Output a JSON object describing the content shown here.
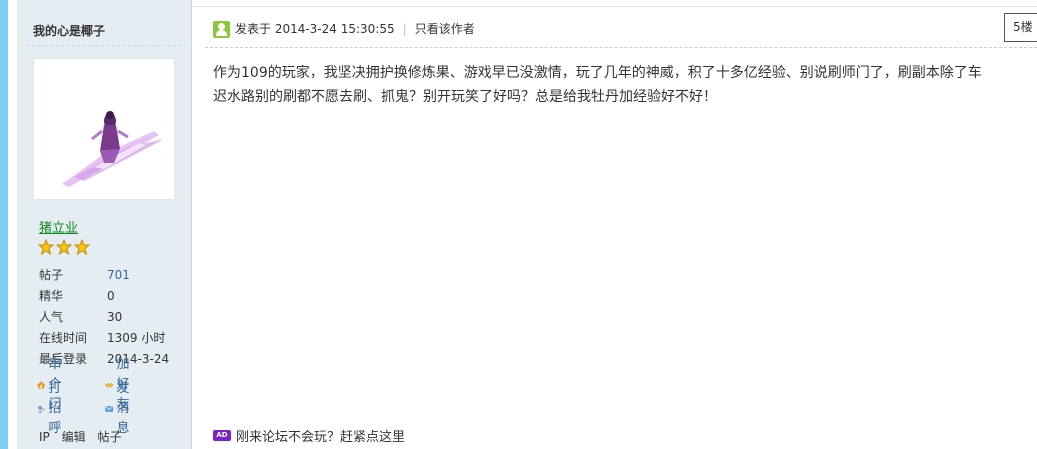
{
  "author": {
    "name": "我的心是椰子",
    "group": "猪立业",
    "stats": [
      {
        "label": "帖子",
        "value": "701"
      },
      {
        "label": "精华",
        "value": "0"
      },
      {
        "label": "人气",
        "value": "30"
      },
      {
        "label": "在线时间",
        "value": "1309 小时"
      },
      {
        "label": "最后登录",
        "value": "2014-3-24"
      }
    ],
    "actions": {
      "visit": "串个门",
      "add_friend": "加好友",
      "greet": "打招呼",
      "message": "发消息"
    },
    "footer": [
      "IP",
      "编辑",
      "帖子"
    ],
    "star_count": 3
  },
  "post": {
    "posted_at": "发表于 2014-3-24 15:30:55",
    "only_author": "只看该作者",
    "floor": "5楼",
    "content_line1": "作为109的玩家，我坚决拥护换修炼果、游戏早已没激情，玩了几年的神威，积了十多亿经验、别说刷师门了，刷副本除了车",
    "content_line2": "迟水路别的刷都不愿去刷、抓鬼？别开玩笑了好吗？总是给我牡丹加经验好不好！"
  },
  "ad": {
    "badge": "AD",
    "text": "刚来论坛不会玩？赶紧点这里"
  },
  "colors": {
    "sidebar_bg": "#e5edf2",
    "link": "#336699",
    "group": "#0f8a1c",
    "accent_edge": "#7fcdf3"
  }
}
